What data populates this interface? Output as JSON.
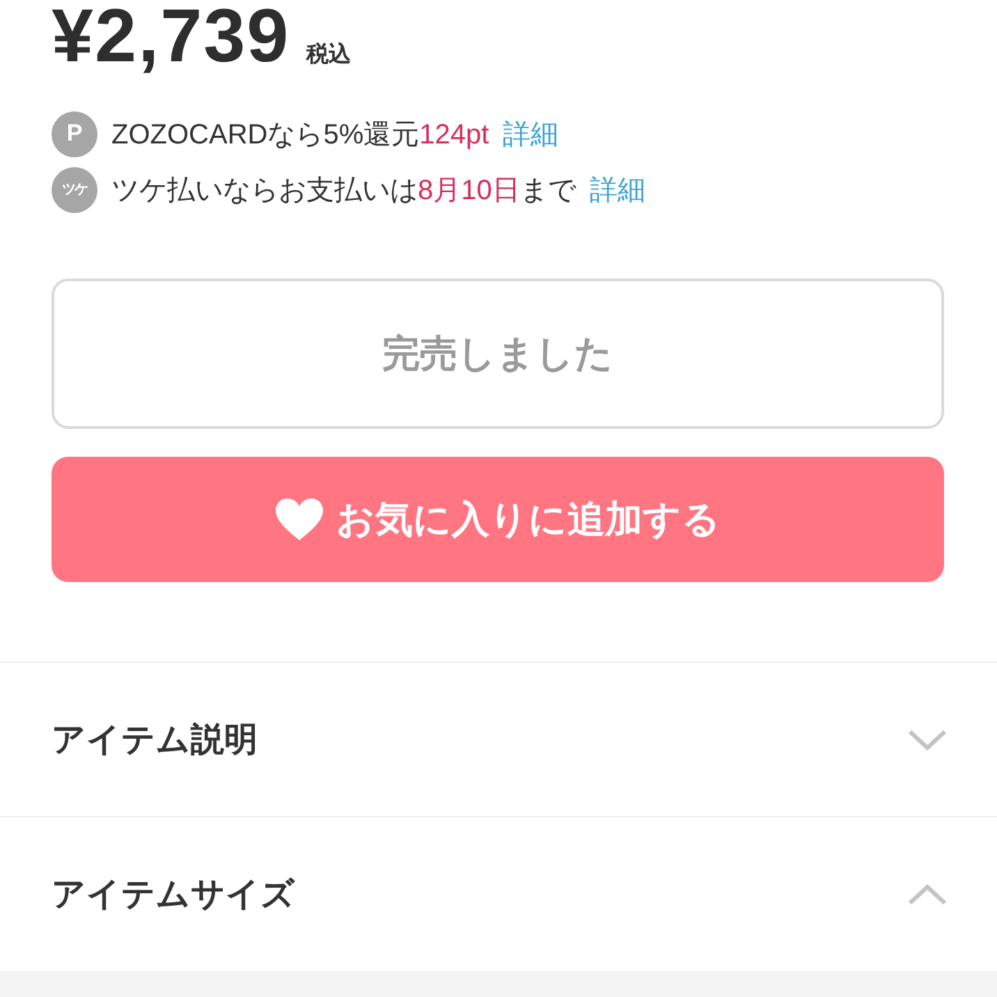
{
  "price": {
    "amount": "¥2,739",
    "tax_note": "税込"
  },
  "benefits": [
    {
      "kind": "points",
      "badge": "P",
      "segments": [
        {
          "text": "ZOZOCARDなら5%還元",
          "highlight": false
        },
        {
          "text": "124pt",
          "highlight": true
        }
      ],
      "link": "詳細"
    },
    {
      "kind": "pay-later",
      "badge": "ツケ",
      "segments": [
        {
          "text": "ツケ払いならお支払いは",
          "highlight": false
        },
        {
          "text": "8月10日",
          "highlight": true
        },
        {
          "text": "まで",
          "highlight": false
        }
      ],
      "link": "詳細"
    }
  ],
  "sold_out_button": {
    "label": "完売しました",
    "disabled": true
  },
  "favorite_button": {
    "label": "お気に入りに追加する"
  },
  "sections": [
    {
      "title": "アイテム説明",
      "expanded": false
    },
    {
      "title": "アイテムサイズ",
      "expanded": true
    }
  ]
}
